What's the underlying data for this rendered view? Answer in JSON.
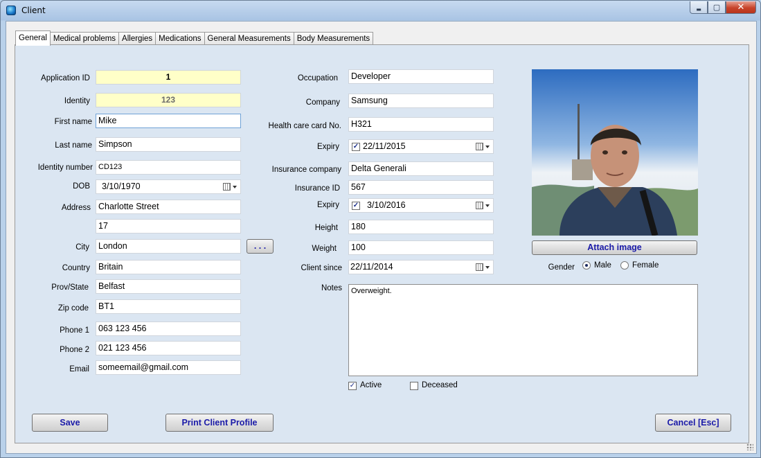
{
  "window": {
    "title": "Client",
    "min_glyph": "▬",
    "max_glyph": "▢",
    "close_glyph": "✕"
  },
  "tabs": [
    "General",
    "Medical problems",
    "Allergies",
    "Medications",
    "General Measurements",
    "Body Measurements"
  ],
  "left": {
    "application_id": {
      "label": "Application ID",
      "value": "1"
    },
    "identity": {
      "label": "Identity",
      "value": "123"
    },
    "first_name": {
      "label": "First name",
      "value": "Mike"
    },
    "last_name": {
      "label": "Last name",
      "value": "Simpson"
    },
    "identity_number": {
      "label": "Identity number",
      "value": "CD123"
    },
    "dob": {
      "label": "DOB",
      "value": "3/10/1970"
    },
    "address": {
      "label": "Address",
      "line1": "Charlotte Street",
      "line2": "17"
    },
    "city": {
      "label": "City",
      "value": "London",
      "browse_label": ". . ."
    },
    "country": {
      "label": "Country",
      "value": "Britain"
    },
    "prov_state": {
      "label": "Prov/State",
      "value": "Belfast"
    },
    "zip": {
      "label": "Zip code",
      "value": "BT1"
    },
    "phone1": {
      "label": "Phone 1",
      "value": "063 123 456"
    },
    "phone2": {
      "label": "Phone 2",
      "value": "021 123 456"
    },
    "email": {
      "label": "Email",
      "value": "someemail@gmail.com"
    }
  },
  "middle": {
    "occupation": {
      "label": "Occupation",
      "value": "Developer"
    },
    "company": {
      "label": "Company",
      "value": "Samsung"
    },
    "health_card": {
      "label": "Health care card No.",
      "value": "H321"
    },
    "health_expiry": {
      "label": "Expiry",
      "value": "22/11/2015",
      "checked": true
    },
    "insurance_company": {
      "label": "Insurance company",
      "value": "Delta Generali"
    },
    "insurance_id": {
      "label": "Insurance ID",
      "value": "567"
    },
    "insurance_expiry": {
      "label": "Expiry",
      "value": "3/10/2016",
      "checked": true
    },
    "height": {
      "label": "Height",
      "value": "180"
    },
    "weight": {
      "label": "Weight",
      "value": "100"
    },
    "client_since": {
      "label": "Client since",
      "value": "22/11/2014"
    },
    "notes": {
      "label": "Notes",
      "value": "Overweight."
    },
    "active": {
      "label": "Active",
      "checked": true
    },
    "deceased": {
      "label": "Deceased",
      "checked": false
    }
  },
  "right": {
    "attach_label": "Attach image",
    "gender_label": "Gender",
    "male_label": "Male",
    "female_label": "Female",
    "selected_gender": "Male"
  },
  "buttons": {
    "save": "Save",
    "print": "Print Client Profile",
    "cancel": "Cancel [Esc]"
  },
  "check_glyph": "✓"
}
